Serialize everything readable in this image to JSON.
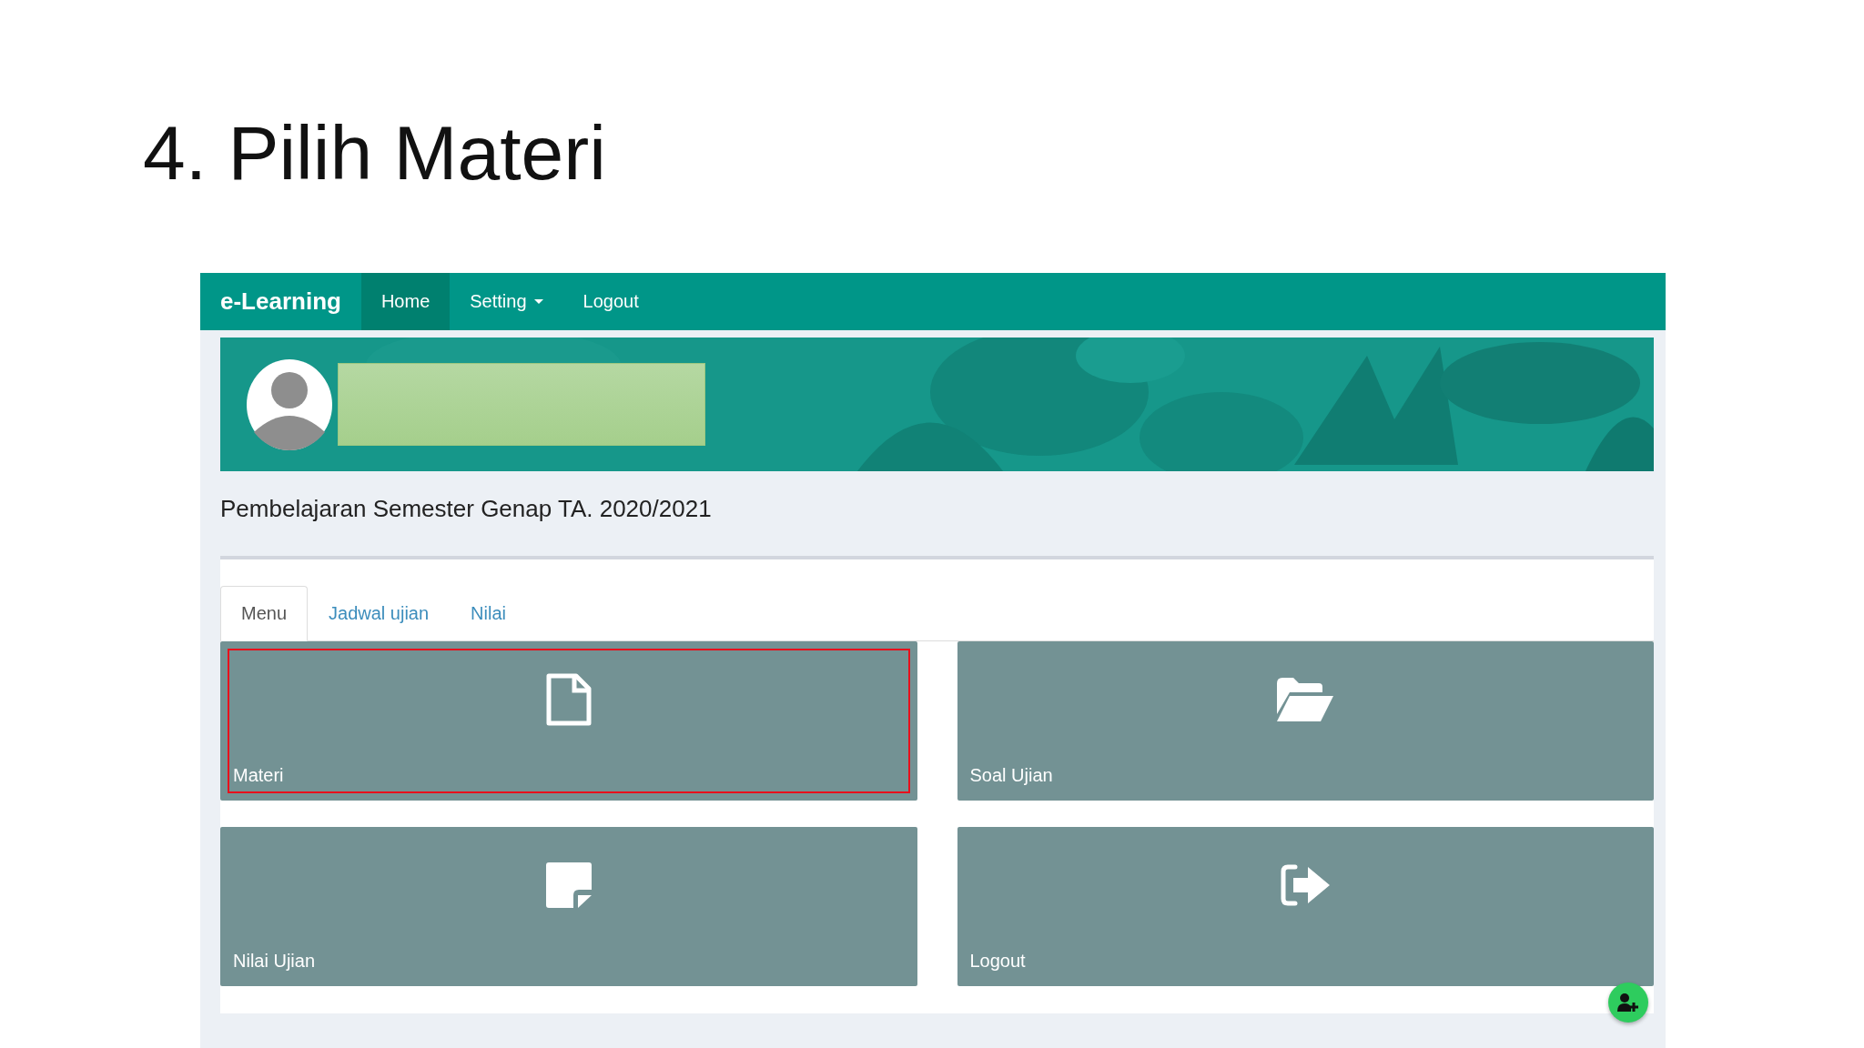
{
  "slide": {
    "title": "4. Pilih Materi"
  },
  "navbar": {
    "brand": "e-Learning",
    "items": [
      {
        "label": "Home",
        "selected": true,
        "dropdown": false
      },
      {
        "label": "Setting",
        "selected": false,
        "dropdown": true
      },
      {
        "label": "Logout",
        "selected": false,
        "dropdown": false
      }
    ]
  },
  "semester": "Pembelajaran Semester Genap TA. 2020/2021",
  "tabs": [
    {
      "label": "Menu",
      "selected": true
    },
    {
      "label": "Jadwal ujian",
      "selected": false
    },
    {
      "label": "Nilai",
      "selected": false
    }
  ],
  "tiles": [
    {
      "label": "Materi",
      "kind": "file",
      "highlighted": true
    },
    {
      "label": "Soal Ujian",
      "kind": "folder",
      "highlighted": false
    },
    {
      "label": "Nilai Ujian",
      "kind": "note",
      "highlighted": false
    },
    {
      "label": "Logout",
      "kind": "logout",
      "highlighted": false
    }
  ]
}
